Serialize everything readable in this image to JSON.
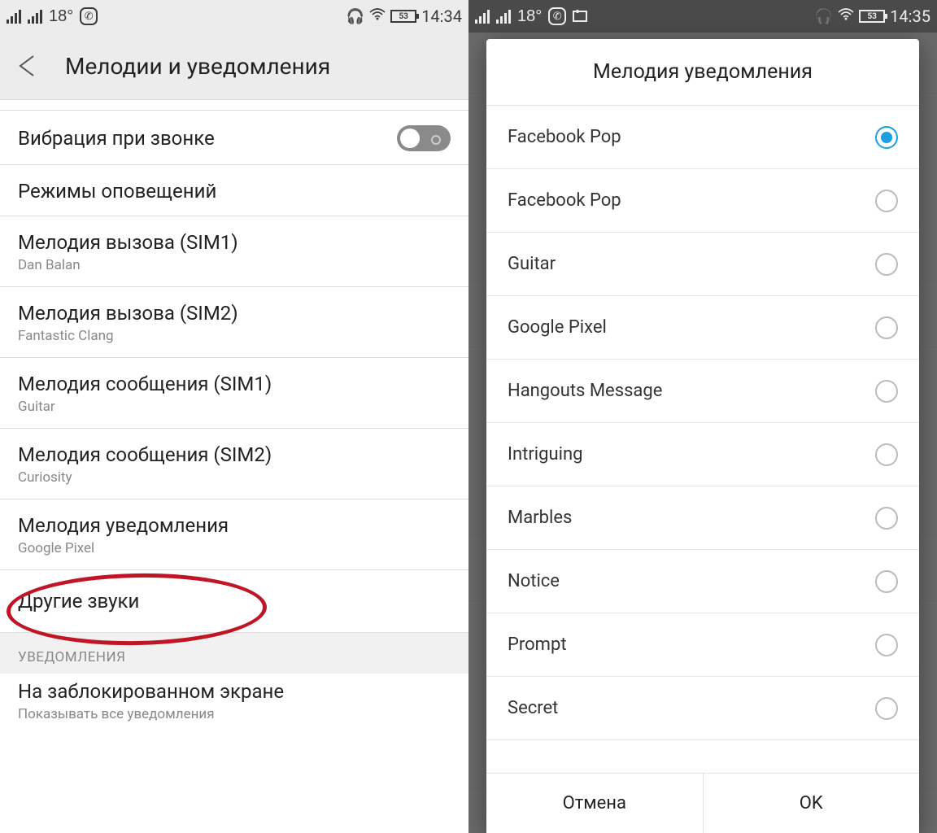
{
  "left": {
    "status": {
      "temp": "18°",
      "battery": "53",
      "time": "14:34"
    },
    "title": "Мелодии и уведомления",
    "rows": {
      "vibration": {
        "title": "Вибрация при звонке"
      },
      "modes": {
        "title": "Режимы оповещений"
      },
      "ring1": {
        "title": "Мелодия вызова (SIM1)",
        "sub": "Dan Balan"
      },
      "ring2": {
        "title": "Мелодия вызова (SIM2)",
        "sub": "Fantastic Clang"
      },
      "msg1": {
        "title": "Мелодия сообщения (SIM1)",
        "sub": "Guitar"
      },
      "msg2": {
        "title": "Мелодия сообщения (SIM2)",
        "sub": "Curiosity"
      },
      "notif": {
        "title": "Мелодия уведомления",
        "sub": "Google Pixel"
      },
      "other": {
        "title": "Другие звуки"
      }
    },
    "section": "УВЕДОМЛЕНИЯ",
    "lock": {
      "title": "На заблокированном экране",
      "sub": "Показывать все уведомления"
    }
  },
  "right": {
    "status": {
      "temp": "18°",
      "battery": "53",
      "time": "14:35"
    },
    "dialog": {
      "title": "Мелодия уведомления",
      "items": [
        {
          "label": "Facebook Pop",
          "selected": true
        },
        {
          "label": "Facebook Pop",
          "selected": false
        },
        {
          "label": "Guitar",
          "selected": false
        },
        {
          "label": "Google Pixel",
          "selected": false
        },
        {
          "label": "Hangouts Message",
          "selected": false
        },
        {
          "label": "Intriguing",
          "selected": false
        },
        {
          "label": "Marbles",
          "selected": false
        },
        {
          "label": "Notice",
          "selected": false
        },
        {
          "label": "Prompt",
          "selected": false
        },
        {
          "label": "Secret",
          "selected": false
        }
      ],
      "cancel": "Отмена",
      "ok": "OK"
    }
  }
}
